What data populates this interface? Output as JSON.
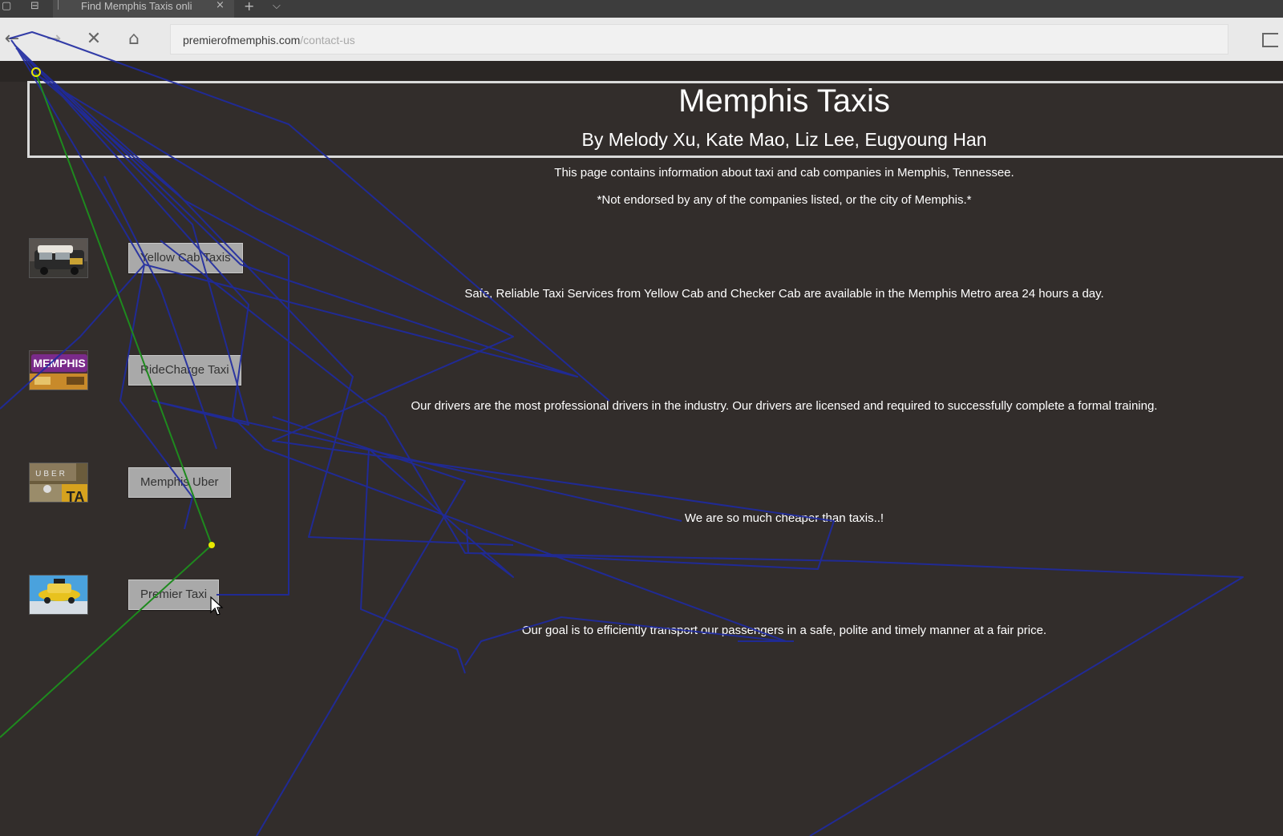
{
  "browser": {
    "tab_title": "Find Memphis Taxis onli",
    "tab_close": "×",
    "new_tab": "+",
    "tab_menu": "⌵",
    "url_host": "premierofmemphis.com",
    "url_path": "/contact-us",
    "nav": {
      "back": "←",
      "forward": "→",
      "stop": "✕",
      "home": "⌂"
    }
  },
  "header": {
    "title": "Memphis Taxis",
    "authors": "By Melody Xu, Kate Mao, Liz Lee, Eugyoung Han"
  },
  "intro": {
    "line1": "This page contains information about taxi and cab companies in Memphis, Tennessee.",
    "line2": "*Not endorsed by any of the companies listed, or the city of Memphis.*"
  },
  "companies": [
    {
      "name": "Yellow Cab Taxis",
      "description": "Safe, Reliable Taxi Services from Yellow Cab and Checker Cab are available in the Memphis Metro area 24 hours a day."
    },
    {
      "name": "RideCharge Taxi",
      "description": "Our drivers are the most professional drivers in the industry. Our drivers are licensed and required to successfully complete a formal training."
    },
    {
      "name": "Memphis Uber",
      "description": "We are so much cheaper than taxis..!"
    },
    {
      "name": "Premier Taxi",
      "description": "Our goal is to efficiently transport our passengers in a safe, polite and timely manner at a fair price."
    }
  ],
  "thumb_text": {
    "memphis_sign": "MEMPHIS",
    "uber": "UBER",
    "taxi": "TA"
  },
  "colors": {
    "page_bg": "#322d2b",
    "button_bg": "#a9a9a9",
    "header_border": "#dadada",
    "trace_blue": "#1f2aa0",
    "trace_green": "#1e8a1e",
    "trace_dot": "#e8e800"
  }
}
